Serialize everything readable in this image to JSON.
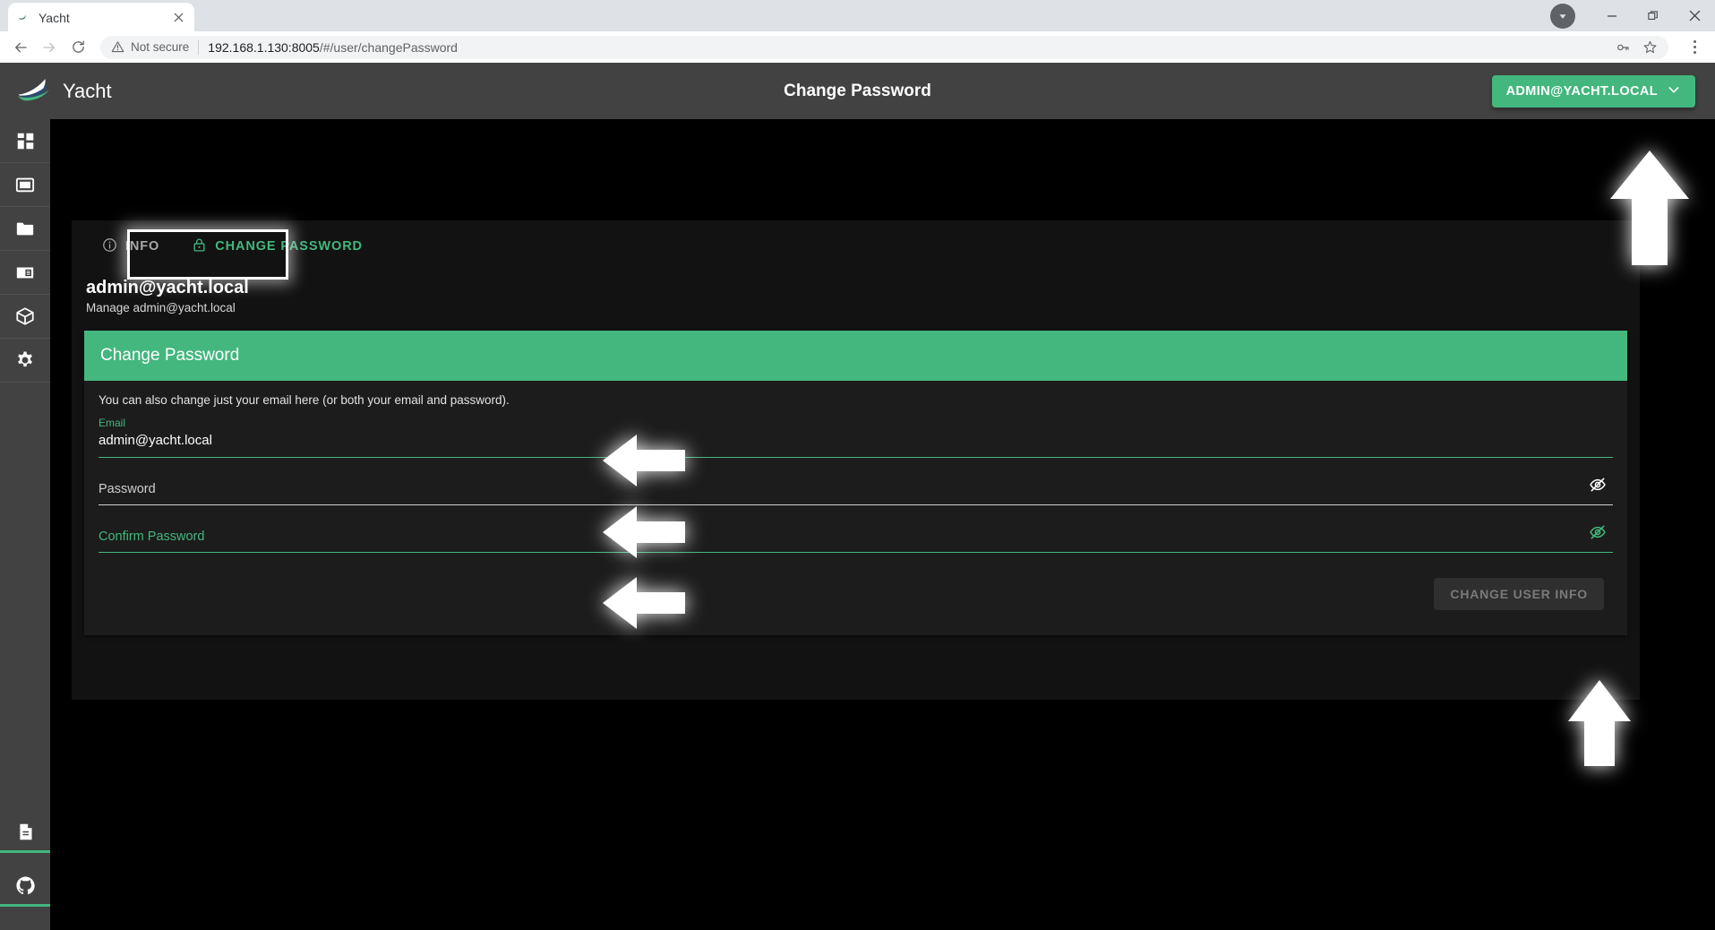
{
  "browser": {
    "tab": {
      "title": "Yacht",
      "favicon_icon": "yacht-favicon",
      "close_icon": "close-icon"
    },
    "window": {
      "profile_icon": "profile-avatar-icon",
      "minimize_icon": "minimize-icon",
      "maximize_icon": "maximize-icon",
      "close_icon": "window-close-icon"
    },
    "toolbar": {
      "back_icon": "back-arrow-icon",
      "forward_icon": "forward-arrow-icon",
      "reload_icon": "reload-icon",
      "security_icon": "warning-triangle-icon",
      "security_text": "Not secure",
      "url_host": "192.168.1.130:8005",
      "url_path": "/#/user/changePassword",
      "password_key_icon": "key-icon",
      "bookmark_icon": "star-icon",
      "menu_icon": "kebab-menu-icon"
    }
  },
  "app": {
    "brand": {
      "name": "Yacht",
      "logo_icon": "yacht-logo-icon"
    },
    "header_title": "Change Password",
    "user_button": {
      "label": "ADMIN@YACHT.LOCAL",
      "chevron_icon": "chevron-down-icon"
    },
    "sidebar": {
      "items": [
        {
          "name": "dashboard",
          "icon": "dashboard-grid-icon"
        },
        {
          "name": "applications",
          "icon": "window-icon"
        },
        {
          "name": "projects",
          "icon": "folder-icon"
        },
        {
          "name": "templates",
          "icon": "book-icon"
        },
        {
          "name": "resources",
          "icon": "cube-icon"
        },
        {
          "name": "settings",
          "icon": "gear-icon"
        }
      ],
      "bottom_items": [
        {
          "name": "docs",
          "icon": "document-icon"
        },
        {
          "name": "github",
          "icon": "github-icon"
        }
      ]
    },
    "tabs": [
      {
        "label": "INFO",
        "icon": "info-circle-icon",
        "active": false
      },
      {
        "label": "CHANGE PASSWORD",
        "icon": "lock-icon",
        "active": true
      }
    ],
    "page": {
      "title": "admin@yacht.local",
      "subtitle": "Manage admin@yacht.local"
    },
    "card": {
      "title": "Change Password",
      "hint": "You can also change just your email here (or both your email and password).",
      "fields": [
        {
          "label": "Email",
          "value": "admin@yacht.local",
          "state": "filled-green"
        },
        {
          "label": "Password",
          "value": "",
          "state": "empty-white",
          "eye_icon": "eye-off-icon"
        },
        {
          "label": "Confirm Password",
          "value": "",
          "state": "empty-green",
          "eye_icon": "eye-off-icon"
        }
      ],
      "submit_label": "CHANGE USER INFO"
    },
    "colors": {
      "accent_green": "#43b77e",
      "appbar": "#424242",
      "panel": "#121212",
      "card": "#1c1c1c"
    }
  },
  "annotations": [
    {
      "name": "arrow-to-user-button",
      "direction": "up"
    },
    {
      "name": "arrow-to-email-field",
      "direction": "left"
    },
    {
      "name": "arrow-to-password-field",
      "direction": "left"
    },
    {
      "name": "arrow-to-confirm-password-field",
      "direction": "left"
    },
    {
      "name": "arrow-to-change-user-info-button",
      "direction": "up"
    }
  ]
}
